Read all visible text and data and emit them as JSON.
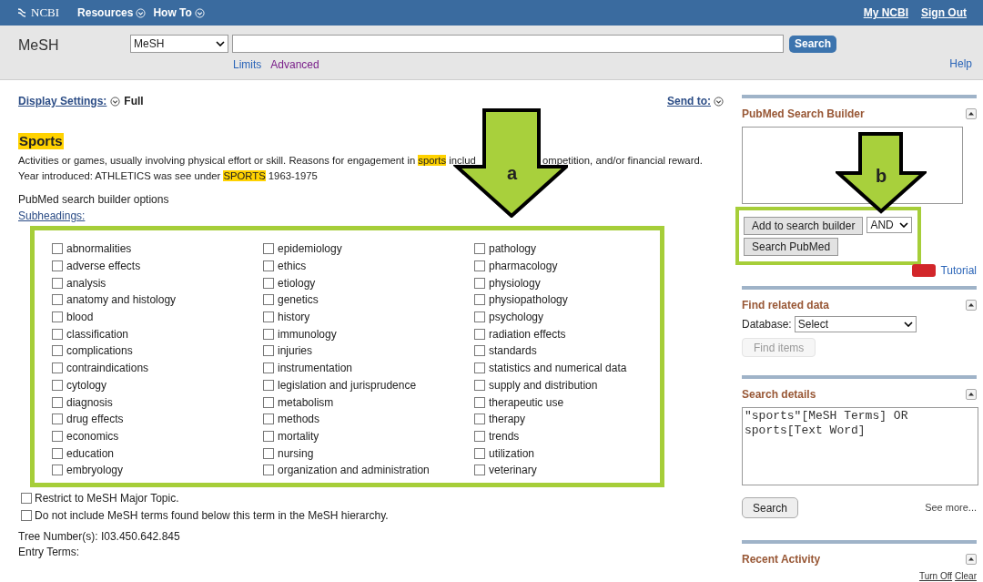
{
  "topbar": {
    "logo": "NCBI",
    "menus": [
      {
        "label": "Resources"
      },
      {
        "label": "How To"
      }
    ],
    "links": [
      "My NCBI",
      "Sign Out"
    ]
  },
  "header": {
    "title": "MeSH",
    "database": "MeSH",
    "button": "Search",
    "links": [
      {
        "label": "Limits",
        "visited": false
      },
      {
        "label": "Advanced",
        "visited": true
      }
    ],
    "help": "Help"
  },
  "display": {
    "label": "Display Settings:",
    "value": "Full",
    "send_to": "Send to:"
  },
  "term": {
    "title": "Sports",
    "line1_left": [
      {
        "text": "Activities or games, usually involving physical effort or skill. Reasons for engagement in ",
        "highlight": false
      },
      {
        "text": "sports",
        "highlight": true
      },
      {
        "text": " includ",
        "highlight": false
      }
    ],
    "line1_right": "ompetition, and/or financial reward.",
    "line2": [
      {
        "text": "Year introduced: ATHLETICS was see under ",
        "highlight": false
      },
      {
        "text": "SPORTS",
        "highlight": true
      },
      {
        "text": " 1963-1975",
        "highlight": false
      }
    ]
  },
  "builder_options": "PubMed search builder options",
  "subheadings_link": "Subheadings:",
  "subheadings": [
    {
      "label": "abnormalities",
      "checked": false
    },
    {
      "label": "adverse effects",
      "checked": false
    },
    {
      "label": "analysis",
      "checked": false
    },
    {
      "label": "anatomy and histology",
      "checked": false
    },
    {
      "label": "blood",
      "checked": false
    },
    {
      "label": "classification",
      "checked": false
    },
    {
      "label": "complications",
      "checked": false
    },
    {
      "label": "contraindications",
      "checked": false
    },
    {
      "label": "cytology",
      "checked": false
    },
    {
      "label": "diagnosis",
      "checked": false
    },
    {
      "label": "drug effects",
      "checked": false
    },
    {
      "label": "economics",
      "checked": false
    },
    {
      "label": "education",
      "checked": false
    },
    {
      "label": "embryology",
      "checked": false
    },
    {
      "label": "epidemiology",
      "checked": false
    },
    {
      "label": "ethics",
      "checked": false
    },
    {
      "label": "etiology",
      "checked": false
    },
    {
      "label": "genetics",
      "checked": false
    },
    {
      "label": "history",
      "checked": false
    },
    {
      "label": "immunology",
      "checked": false
    },
    {
      "label": "injuries",
      "checked": false
    },
    {
      "label": "instrumentation",
      "checked": false
    },
    {
      "label": "legislation and jurisprudence",
      "checked": false
    },
    {
      "label": "metabolism",
      "checked": false
    },
    {
      "label": "methods",
      "checked": false
    },
    {
      "label": "mortality",
      "checked": false
    },
    {
      "label": "nursing",
      "checked": false
    },
    {
      "label": "organization and administration",
      "checked": false
    },
    {
      "label": "pathology",
      "checked": false
    },
    {
      "label": "pharmacology",
      "checked": false
    },
    {
      "label": "physiology",
      "checked": false
    },
    {
      "label": "physiopathology",
      "checked": false
    },
    {
      "label": "psychology",
      "checked": false
    },
    {
      "label": "radiation effects",
      "checked": false
    },
    {
      "label": "standards",
      "checked": false
    },
    {
      "label": "statistics and numerical data",
      "checked": false
    },
    {
      "label": "supply and distribution",
      "checked": false
    },
    {
      "label": "therapeutic use",
      "checked": false
    },
    {
      "label": "therapy",
      "checked": false
    },
    {
      "label": "trends",
      "checked": false
    },
    {
      "label": "utilization",
      "checked": false
    },
    {
      "label": "veterinary",
      "checked": false
    }
  ],
  "options": [
    {
      "label": "Restrict to MeSH Major Topic.",
      "checked": false
    },
    {
      "label": "Do not include MeSH terms found below this term in the MeSH hierarchy.",
      "checked": false
    }
  ],
  "tree_numbers": "Tree Number(s): I03.450.642.845",
  "entry_terms": "Entry Terms:",
  "sidebar": {
    "builder": {
      "title": "PubMed Search Builder",
      "add_button": "Add to search builder",
      "operator": "AND",
      "search_button": "Search PubMed",
      "tutorial": "Tutorial"
    },
    "related": {
      "title": "Find related data",
      "database_label": "Database:",
      "database": "Select",
      "find_button": "Find items",
      "find_disabled": true
    },
    "details": {
      "title": "Search details",
      "query": "\"sports\"[MeSH Terms] OR sports[Text Word]",
      "search_button": "Search",
      "see_more": "See more..."
    },
    "recent": {
      "title": "Recent Activity",
      "links": [
        "Turn Off",
        "Clear"
      ]
    }
  },
  "annotations": [
    {
      "label": "a"
    },
    {
      "label": "b"
    }
  ]
}
